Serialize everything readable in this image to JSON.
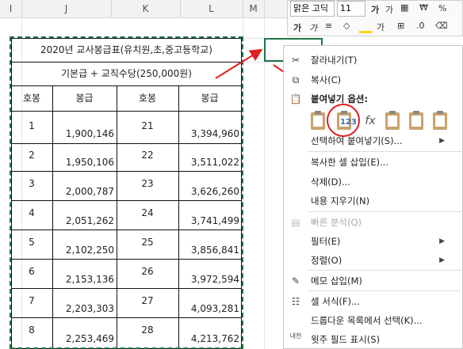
{
  "column_headers": [
    "I",
    "J",
    "K",
    "L",
    "M"
  ],
  "table": {
    "title": "2020년 교사봉급표(유치원,초,중고등학교)",
    "subtitle": "기본급 + 교직수당(250,000원)",
    "headers": [
      "호봉",
      "봉급",
      "호봉",
      "봉급"
    ],
    "rows": [
      {
        "g1": "1",
        "p1": "1,900,146",
        "g2": "21",
        "p2": "3,394,960"
      },
      {
        "g1": "2",
        "p1": "1,950,106",
        "g2": "22",
        "p2": "3,511,022"
      },
      {
        "g1": "3",
        "p1": "2,000,787",
        "g2": "23",
        "p2": "3,626,260"
      },
      {
        "g1": "4",
        "p1": "2,051,262",
        "g2": "24",
        "p2": "3,741,499"
      },
      {
        "g1": "5",
        "p1": "2,102,250",
        "g2": "25",
        "p2": "3,856,841"
      },
      {
        "g1": "6",
        "p1": "2,153,136",
        "g2": "26",
        "p2": "3,972,594"
      },
      {
        "g1": "7",
        "p1": "2,203,303",
        "g2": "27",
        "p2": "4,093,281"
      },
      {
        "g1": "8",
        "p1": "2,253,469",
        "g2": "28",
        "p2": "4,213,762"
      }
    ]
  },
  "mini_toolbar": {
    "font_name": "맑은 고딕",
    "font_size": "11",
    "percent": "%",
    "bold": "가",
    "italic": "가"
  },
  "context_menu": {
    "cut": "잘라내기(T)",
    "copy": "복사(C)",
    "paste_options": "붙여넣기 옵션:",
    "paste_values_tag": "123",
    "paste_special": "선택하여 붙여넣기(S)...",
    "insert_copied": "복사한 셀 삽입(E)...",
    "delete": "삭제(D)...",
    "clear": "내용 지우기(N)",
    "quick_analysis": "빠른 분석(Q)",
    "filter": "필터(E)",
    "sort": "정렬(O)",
    "insert_comment": "메모 삽입(M)",
    "format_cells": "셀 서식(F)...",
    "pick_from_list": "드롭다운 목록에서 선택(K)...",
    "phonetic": "윗주 필드 표시(S)",
    "phonetic_icon_text": "내천"
  },
  "colors": {
    "accent": "#217346",
    "annotation": "#e02020"
  }
}
